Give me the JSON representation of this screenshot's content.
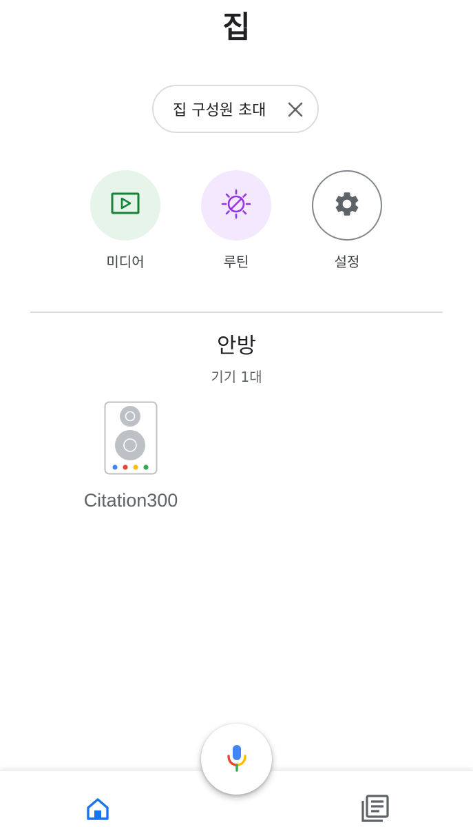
{
  "header": {
    "title": "집"
  },
  "invite_chip": {
    "label": "집 구성원 초대",
    "close_icon": "close-icon"
  },
  "actions": [
    {
      "label": "미디어",
      "icon": "media-play-icon",
      "bg": "#e6f4ea",
      "color": "#188038"
    },
    {
      "label": "루틴",
      "icon": "routine-icon",
      "bg": "#f3e8fd",
      "color": "#9334e6"
    },
    {
      "label": "설정",
      "icon": "gear-icon",
      "bg": "#ffffff",
      "color": "#5f6368"
    }
  ],
  "room": {
    "name": "안방",
    "device_count": "기기 1대",
    "devices": [
      {
        "name": "Citation300",
        "icon": "speaker-icon"
      }
    ]
  },
  "bottom_nav": {
    "home_icon": "home-icon",
    "feed_icon": "feed-icon",
    "active": "home",
    "active_color": "#1a73e8"
  },
  "mic": {
    "icon": "microphone-icon",
    "colors": [
      "#4285f4",
      "#ea4335",
      "#fbbc04",
      "#34a853"
    ]
  }
}
